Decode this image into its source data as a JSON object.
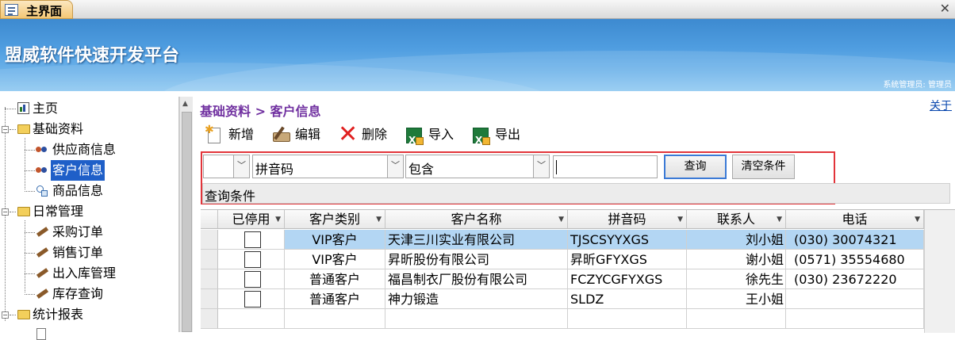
{
  "tab": {
    "title": "主界面",
    "close": "✕"
  },
  "header": {
    "app_title": "盟威软件快速开发平台",
    "user_info": "系统管理员: 管理员"
  },
  "tree": {
    "items": [
      {
        "label": "主页",
        "icon": "chart-icon"
      },
      {
        "label": "基础资料",
        "icon": "folder-icon",
        "expander": "−"
      },
      {
        "label": "供应商信息",
        "icon": "people-icon"
      },
      {
        "label": "客户信息",
        "icon": "people-icon",
        "selected": true
      },
      {
        "label": "商品信息",
        "icon": "item-icon"
      },
      {
        "label": "日常管理",
        "icon": "folder-icon",
        "expander": "−"
      },
      {
        "label": "采购订单",
        "icon": "pen-icon"
      },
      {
        "label": "销售订单",
        "icon": "pen-icon"
      },
      {
        "label": "出入库管理",
        "icon": "pen-icon"
      },
      {
        "label": "库存查询",
        "icon": "pen-icon"
      },
      {
        "label": "统计报表",
        "icon": "folder-icon",
        "expander": "−"
      }
    ]
  },
  "main": {
    "breadcrumb": "基础资料 > 客户信息",
    "about": "关于",
    "toolbar": {
      "new_label": "新增",
      "edit_label": "编辑",
      "delete_label": "删除",
      "import_label": "导入",
      "export_label": "导出"
    },
    "filter": {
      "combo1_value": "",
      "combo2_value": "拼音码",
      "combo3_value": "包含",
      "text_value": "",
      "query_label": "查询",
      "clear_label": "清空条件",
      "condition_text": "查询条件"
    },
    "grid": {
      "columns": [
        "已停用",
        "客户类别",
        "客户名称",
        "拼音码",
        "联系人",
        "电话"
      ],
      "rows": [
        {
          "disabled": false,
          "category": "VIP客户",
          "name": "天津三川实业有限公司",
          "pinyin": "TJSCSYYXGS",
          "contact": "刘小姐",
          "phone": "(030) 30074321",
          "selected": true
        },
        {
          "disabled": false,
          "category": "VIP客户",
          "name": "昇昕股份有限公司",
          "pinyin": "昇昕GFYXGS",
          "contact": "谢小姐",
          "phone": "(0571) 35554680"
        },
        {
          "disabled": false,
          "category": "普通客户",
          "name": "福昌制衣厂股份有限公司",
          "pinyin": "FCZYCGFYXGS",
          "contact": "徐先生",
          "phone": "(030) 23672220"
        },
        {
          "disabled": false,
          "category": "普通客户",
          "name": "神力锻造",
          "pinyin": "SLDZ",
          "contact": "王小姐",
          "phone": ""
        }
      ]
    }
  },
  "colors": {
    "banner": "#4f9de0",
    "breadcrumb": "#7030a0",
    "selection": "#1f5fc8",
    "highlight_box": "#e2343a",
    "row_selected": "#b3d6f3"
  }
}
